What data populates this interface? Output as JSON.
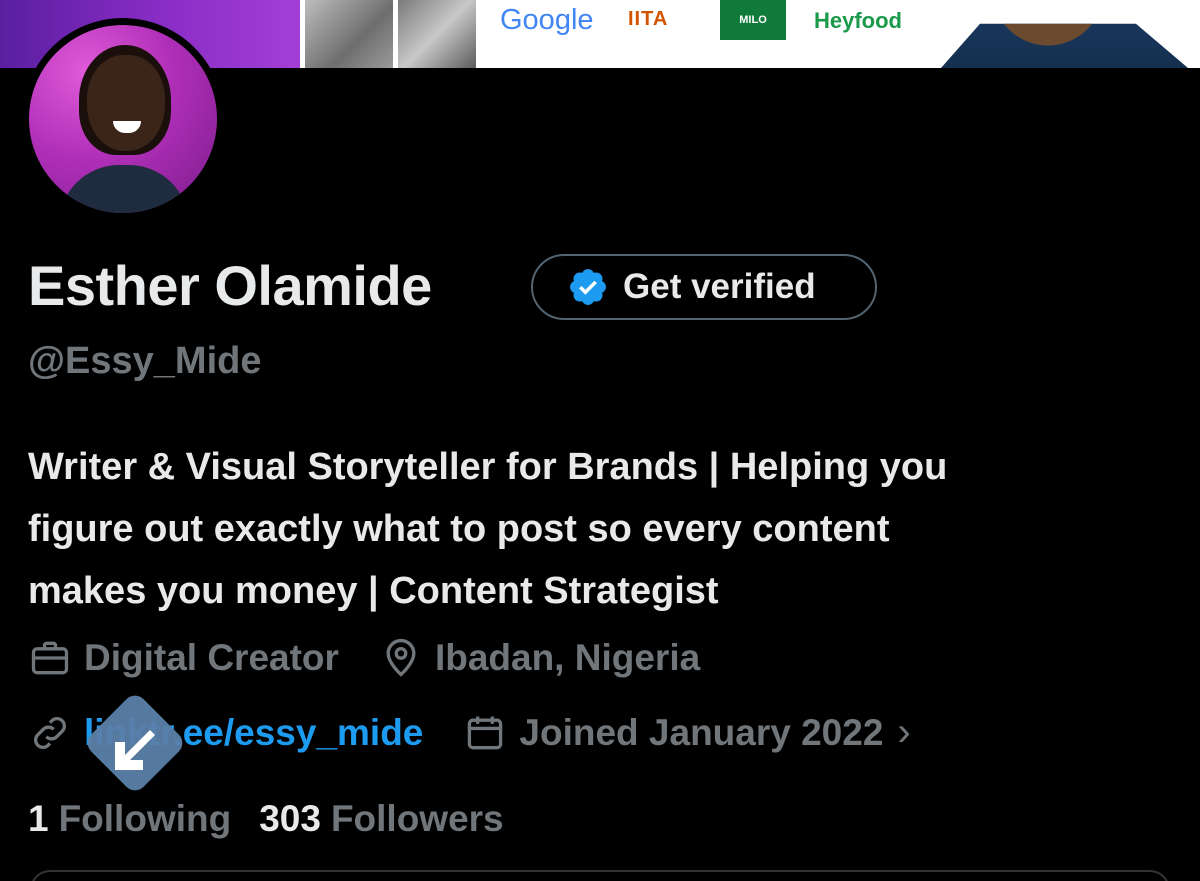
{
  "banner": {
    "sponsors": [
      "Google",
      "IITA",
      "MILO",
      "Heyfood"
    ]
  },
  "profile": {
    "name": "Esther Olamide",
    "handle": "@Essy_Mide",
    "bio_lines": [
      "Writer & Visual Storyteller for Brands | Helping you",
      "figure out exactly what to post so every content",
      "makes you money | Content Strategist"
    ],
    "category": "Digital Creator",
    "location": "Ibadan, Nigeria",
    "website": "linktr.ee/essy_mide",
    "joined": "Joined January 2022"
  },
  "verify": {
    "label": "Get verified",
    "badge_color": "#1d9bf0"
  },
  "stats": {
    "following_count": "1",
    "following_label": "Following",
    "followers_count": "303",
    "followers_label": "Followers"
  },
  "icons": {
    "category": "briefcase-icon",
    "location": "map-pin-icon",
    "website": "link-icon",
    "joined": "calendar-icon",
    "chevron": "chevron-right-icon",
    "cursor": "arrow-cursor-icon"
  },
  "colors": {
    "background": "#000000",
    "primary_text": "#e7e9ea",
    "secondary_text": "#71767b",
    "link": "#1d9bf0",
    "border": "#536471"
  }
}
